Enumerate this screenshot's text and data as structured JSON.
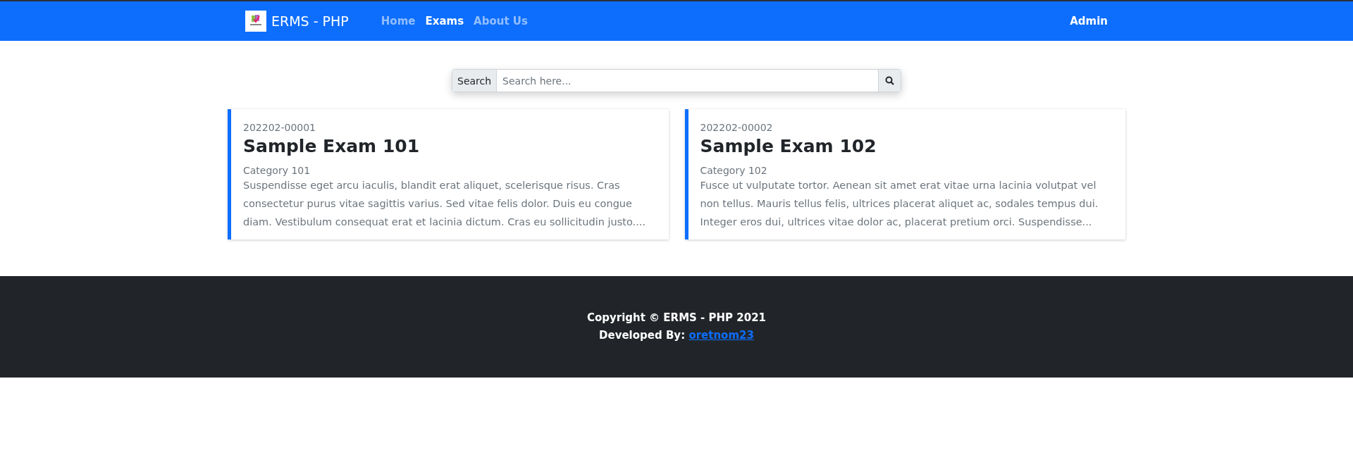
{
  "navbar": {
    "brand": "ERMS - PHP",
    "links": [
      {
        "label": "Home",
        "selected": false
      },
      {
        "label": "Exams",
        "selected": true
      },
      {
        "label": "About Us",
        "selected": false
      }
    ],
    "user": "Admin"
  },
  "search": {
    "label": "Search",
    "placeholder": "Search here..."
  },
  "exams": [
    {
      "code": "202202-00001",
      "title": "Sample Exam 101",
      "category": "Category 101",
      "description": "Suspendisse eget arcu iaculis, blandit erat aliquet, scelerisque risus. Cras consectetur purus vitae sagittis varius. Sed vitae felis dolor. Duis eu congue diam. Vestibulum consequat erat et lacinia dictum. Cras eu sollicitudin justo...."
    },
    {
      "code": "202202-00002",
      "title": "Sample Exam 102",
      "category": "Category 102",
      "description": "Fusce ut vulputate tortor. Aenean sit amet erat vitae urna lacinia volutpat vel non tellus. Mauris tellus felis, ultrices placerat aliquet ac, sodales tempus dui. Integer eros dui, ultrices vitae dolor ac, placerat pretium orci. Suspendisse..."
    }
  ],
  "footer": {
    "copyright": "Copyright © ERMS - PHP 2021",
    "developed_label": "Developed By:",
    "developer_link": "oretnom23"
  }
}
